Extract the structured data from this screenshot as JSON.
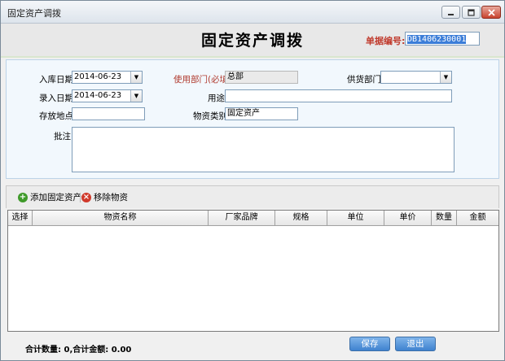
{
  "window": {
    "title": "固定资产调拨",
    "controls": {
      "minimize_icon": "minimize-icon",
      "maximize_icon": "maximize-icon",
      "close_icon": "close-icon"
    }
  },
  "header": {
    "title": "固定资产调拨",
    "doc_no_label": "单据编号:",
    "doc_no_value": "DB1406230001"
  },
  "form": {
    "in_date_label": "入库日期:",
    "in_date_value": "2014-06-23",
    "entry_date_label": "录入日期:",
    "entry_date_value": "2014-06-23",
    "location_label": "存放地点:",
    "location_value": "",
    "use_dept_label": "使用部门(必填):",
    "use_dept_value": "总部",
    "purpose_label": "用途:",
    "purpose_value": "",
    "category_label": "物资类别:",
    "category_value": "固定资产",
    "supplier_dept_label": "供货部门:",
    "supplier_dept_value": "",
    "remark_label": "批注:",
    "remark_value": ""
  },
  "toolbar": {
    "add_label": "添加固定资产",
    "remove_label": "移除物资"
  },
  "grid": {
    "columns": [
      "选择",
      "物资名称",
      "厂家品牌",
      "规格",
      "单位",
      "单价",
      "数量",
      "金额"
    ],
    "rows": []
  },
  "footer": {
    "summary": "合计数量: 0,合计金额: 0.00",
    "save_label": "保存",
    "exit_label": "退出"
  },
  "colors": {
    "accent": "#3f82cf",
    "required_red": "#b03a2e",
    "panel_bg": "#f2f8fd"
  }
}
